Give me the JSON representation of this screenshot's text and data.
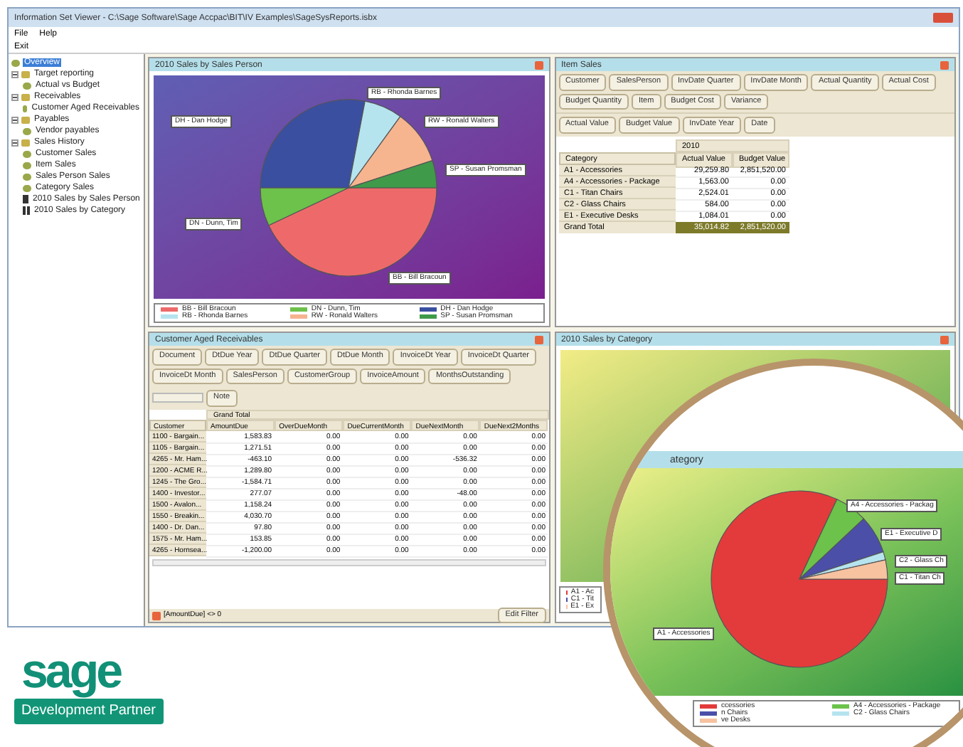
{
  "window": {
    "title": "Information Set Viewer - C:\\Sage Software\\Sage Accpac\\BIT\\IV Examples\\SageSysReports.isbx"
  },
  "menu": [
    "File",
    "Help"
  ],
  "toolbar": [
    "Exit"
  ],
  "tree": [
    {
      "label": "Overview",
      "kind": "page",
      "selected": true
    },
    {
      "label": "Target reporting",
      "kind": "folder",
      "selected": false,
      "expanded": true,
      "children": [
        {
          "label": "Actual vs Budget",
          "kind": "page",
          "selected": false
        }
      ]
    },
    {
      "label": "Receivables",
      "kind": "folder",
      "selected": false,
      "expanded": true,
      "children": [
        {
          "label": "Customer Aged Receivables",
          "kind": "page",
          "selected": false
        }
      ]
    },
    {
      "label": "Payables",
      "kind": "folder",
      "selected": false,
      "expanded": true,
      "children": [
        {
          "label": "Vendor payables",
          "kind": "page",
          "selected": false
        }
      ]
    },
    {
      "label": "Sales History",
      "kind": "folder",
      "selected": false,
      "expanded": true,
      "children": [
        {
          "label": "Customer Sales",
          "kind": "page",
          "selected": false
        },
        {
          "label": "Item Sales",
          "kind": "page",
          "selected": false
        },
        {
          "label": "Sales Person Sales",
          "kind": "page",
          "selected": false
        },
        {
          "label": "Category Sales",
          "kind": "page",
          "selected": false
        },
        {
          "label": "2010 Sales by Sales Person",
          "kind": "chart",
          "selected": false
        },
        {
          "label": "2010 Sales by Category",
          "kind": "chart",
          "selected": false
        }
      ]
    }
  ],
  "sales_person_panel": {
    "title": "2010 Sales by Sales Person",
    "slice_labels": [
      "DH - Dan Hodge",
      "RB - Rhonda Barnes",
      "RW - Ronald Walters",
      "SP - Susan Promsman",
      "DN - Dunn, Tim",
      "BB - Bill Bracoun"
    ],
    "legend": [
      {
        "label": "BB - Bill Bracoun",
        "color": "#ee6a6a"
      },
      {
        "label": "DN - Dunn, Tim",
        "color": "#6cc24a"
      },
      {
        "label": "DH - Dan Hodge",
        "color": "#3b4fa0"
      },
      {
        "label": "RB - Rhonda Barnes",
        "color": "#b5e4ef"
      },
      {
        "label": "RW - Ronald Walters",
        "color": "#f6b48f"
      },
      {
        "label": "SP - Susan Promsman",
        "color": "#3f9a4a"
      }
    ]
  },
  "item_sales_panel": {
    "title": "Item Sales",
    "field_buttons": [
      "Customer",
      "SalesPerson",
      "InvDate Quarter",
      "InvDate Month",
      "Actual Quantity",
      "Actual Cost",
      "Budget Quantity",
      "Item",
      "Budget Cost",
      "Variance"
    ],
    "data_buttons": [
      "Actual Value",
      "Budget Value"
    ],
    "column_field": "InvDate Year",
    "extra_button": "Date",
    "row_field": "Category",
    "column_group": "2010",
    "columns": [
      "Actual Value",
      "Budget Value"
    ],
    "rows": [
      {
        "label": "A1 - Accessories",
        "cells": [
          "29,259.80",
          "2,851,520.00"
        ]
      },
      {
        "label": "A4 - Accessories - Package",
        "cells": [
          "1,563.00",
          "0.00"
        ]
      },
      {
        "label": "C1 - Titan Chairs",
        "cells": [
          "2,524.01",
          "0.00"
        ]
      },
      {
        "label": "C2 - Glass Chairs",
        "cells": [
          "584.00",
          "0.00"
        ]
      },
      {
        "label": "E1 - Executive Desks",
        "cells": [
          "1,084.01",
          "0.00"
        ]
      }
    ],
    "total": {
      "label": "Grand Total",
      "cells": [
        "35,014.82",
        "2,851,520.00"
      ]
    }
  },
  "receivables_panel": {
    "title": "Customer Aged Receivables",
    "field_buttons": [
      "Document",
      "DtDue Year",
      "DtDue Quarter",
      "DtDue Month",
      "InvoiceDt Year",
      "InvoiceDt Quarter",
      "InvoiceDt Month",
      "SalesPerson",
      "CustomerGroup",
      "InvoiceAmount",
      "MonthsOutstanding"
    ],
    "data_button": "Note",
    "column_group": "Grand Total",
    "row_field": "Customer",
    "columns": [
      "AmountDue",
      "OverDueMonth",
      "DueCurrentMonth",
      "DueNextMonth",
      "DueNext2Months"
    ],
    "rows": [
      {
        "label": "1100 - Bargain...",
        "cells": [
          "1,583.83",
          "0.00",
          "0.00",
          "0.00",
          "0.00"
        ]
      },
      {
        "label": "1105 - Bargain...",
        "cells": [
          "1,271.51",
          "0.00",
          "0.00",
          "0.00",
          "0.00"
        ]
      },
      {
        "label": "4265 - Mr. Ham...",
        "cells": [
          "-463.10",
          "0.00",
          "0.00",
          "-536.32",
          "0.00"
        ]
      },
      {
        "label": "1200 - ACME R...",
        "cells": [
          "1,289.80",
          "0.00",
          "0.00",
          "0.00",
          "0.00"
        ]
      },
      {
        "label": "1245 - The Gro...",
        "cells": [
          "-1,584.71",
          "0.00",
          "0.00",
          "0.00",
          "0.00"
        ]
      },
      {
        "label": "1400 - Investor...",
        "cells": [
          "277.07",
          "0.00",
          "0.00",
          "-48.00",
          "0.00"
        ]
      },
      {
        "label": "1500 - Avalon...",
        "cells": [
          "1,158.24",
          "0.00",
          "0.00",
          "0.00",
          "0.00"
        ]
      },
      {
        "label": "1550 - Breakin...",
        "cells": [
          "4,030.70",
          "0.00",
          "0.00",
          "0.00",
          "0.00"
        ]
      },
      {
        "label": "1400 - Dr. Dan...",
        "cells": [
          "97.80",
          "0.00",
          "0.00",
          "0.00",
          "0.00"
        ]
      },
      {
        "label": "1575 - Mr. Ham...",
        "cells": [
          "153.85",
          "0.00",
          "0.00",
          "0.00",
          "0.00"
        ]
      },
      {
        "label": "4265 - Hornsea...",
        "cells": [
          "-1,200.00",
          "0.00",
          "0.00",
          "0.00",
          "0.00"
        ]
      }
    ],
    "filter": "[AmountDue] <> 0",
    "filter_button": "Edit Filter"
  },
  "category_panel": {
    "title": "2010 Sales by Category",
    "legend": [
      {
        "label": "A1 - Ac",
        "color": "#e33b3b"
      },
      {
        "label": "C1 - Tit",
        "color": "#4b4fa8"
      },
      {
        "label": "E1 - Ex",
        "color": "#f7c2a0"
      }
    ]
  },
  "magnifier": {
    "title": "ategory",
    "slice_labels": [
      "A4 - Accessories - Packag",
      "E1 - Executive D",
      "C2 - Glass Ch",
      "C1 - Titan Ch",
      "A1 - Accessories"
    ],
    "legend": [
      {
        "label": "ccessories",
        "color": "#e33b3b"
      },
      {
        "label": "A4 - Accessories - Package",
        "color": "#6cc24a"
      },
      {
        "label": "n Chairs",
        "color": "#4b4fa8"
      },
      {
        "label": "C2 - Glass Chairs",
        "color": "#b5e4ef"
      },
      {
        "label": "ve Desks",
        "color": "#f7c2a0"
      }
    ]
  },
  "logo": {
    "wordmark": "sage",
    "badge": "Development Partner"
  }
}
